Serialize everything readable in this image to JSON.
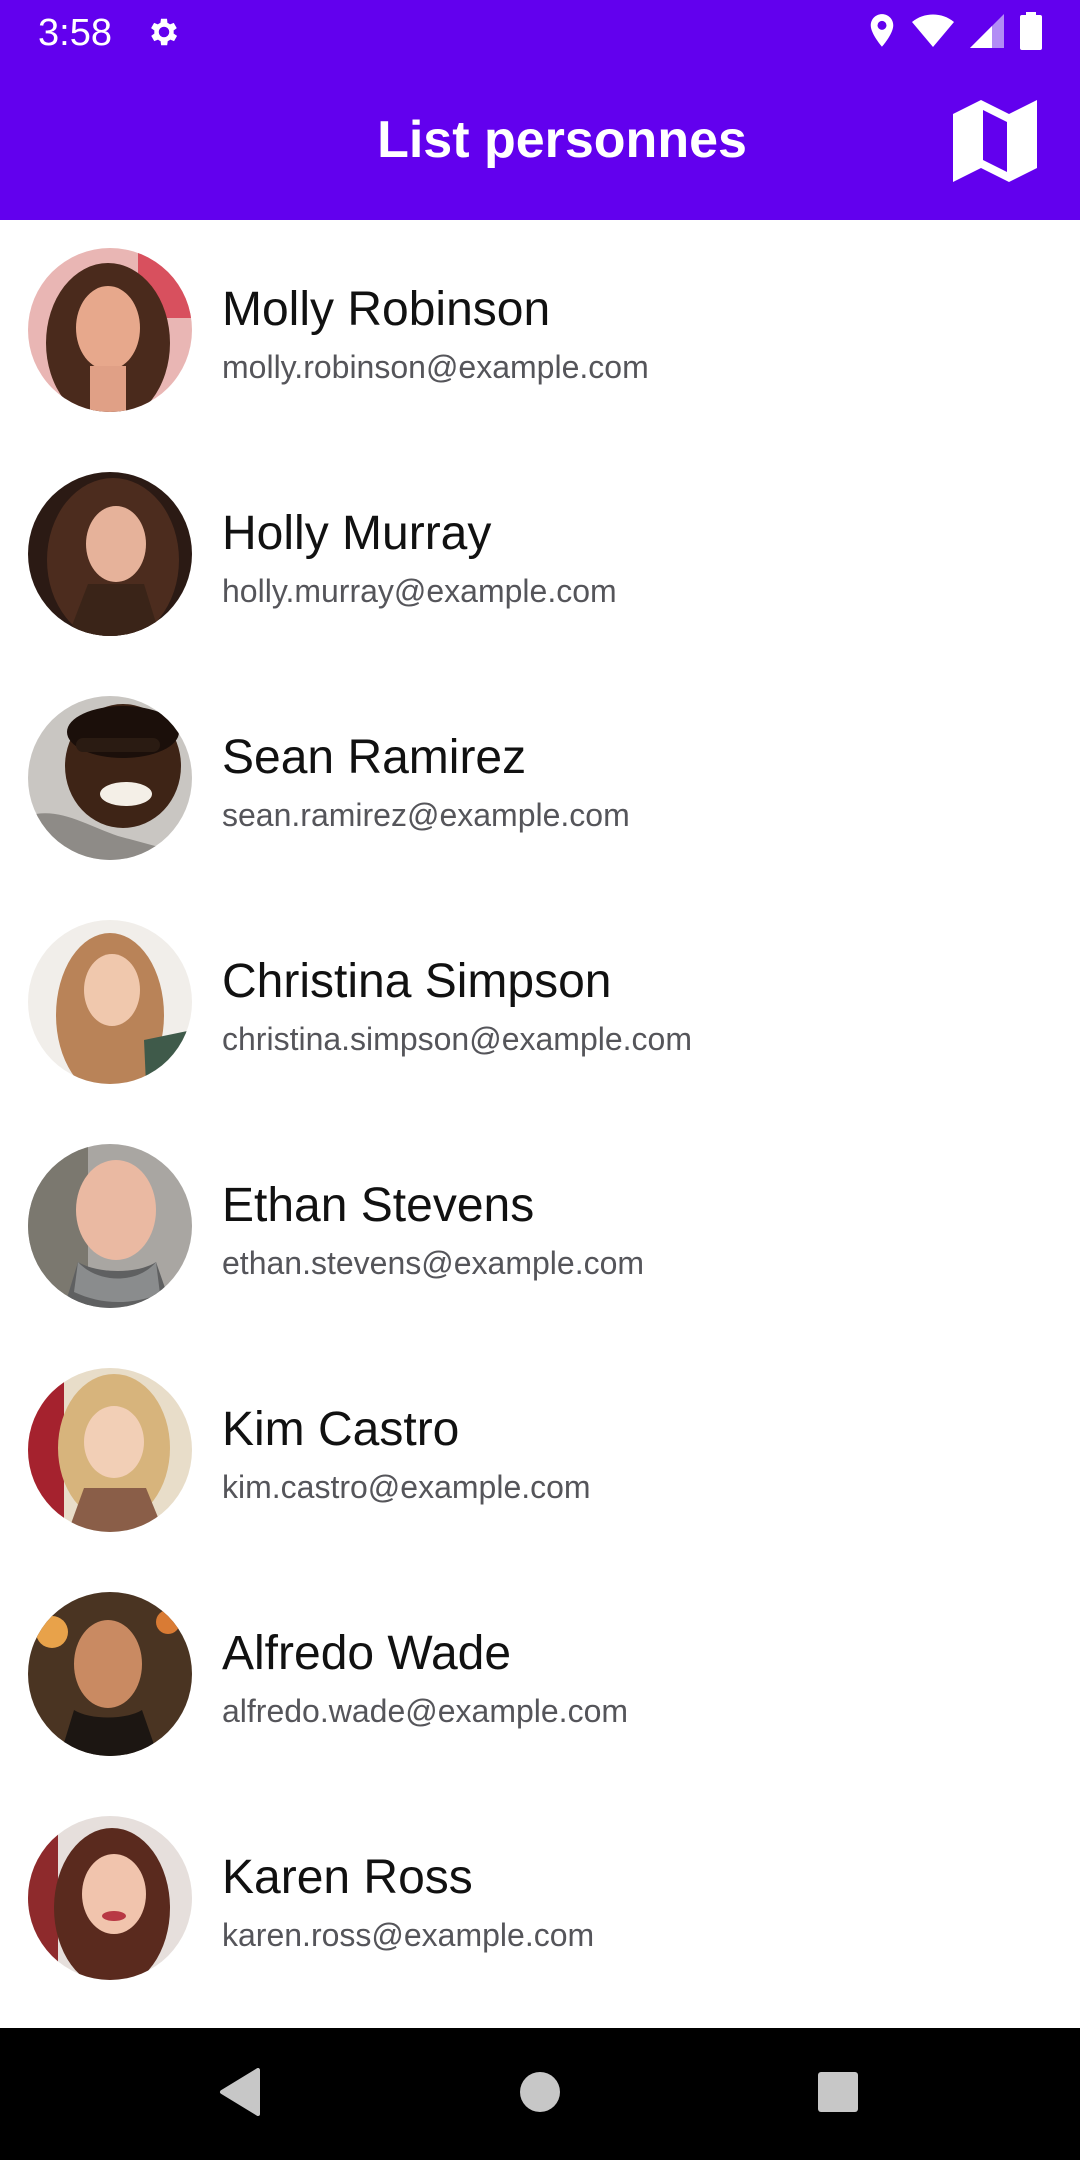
{
  "status_bar": {
    "time": "3:58",
    "left_icons": [
      "settings-icon"
    ],
    "right_icons": [
      "location-icon",
      "wifi-icon",
      "cell-signal-icon",
      "battery-icon"
    ],
    "background": "#6200ee"
  },
  "app_bar": {
    "title": "List personnes",
    "action_icon": "map-icon",
    "background": "#6200ee"
  },
  "people": [
    {
      "name": "Molly Robinson",
      "email": "molly.robinson@example.com"
    },
    {
      "name": "Holly Murray",
      "email": "holly.murray@example.com"
    },
    {
      "name": "Sean Ramirez",
      "email": "sean.ramirez@example.com"
    },
    {
      "name": "Christina Simpson",
      "email": "christina.simpson@example.com"
    },
    {
      "name": "Ethan Stevens",
      "email": "ethan.stevens@example.com"
    },
    {
      "name": "Kim Castro",
      "email": "kim.castro@example.com"
    },
    {
      "name": "Alfredo Wade",
      "email": "alfredo.wade@example.com"
    },
    {
      "name": "Karen Ross",
      "email": "karen.ross@example.com"
    }
  ],
  "nav_bar": {
    "buttons": [
      "back-icon",
      "home-icon",
      "recents-icon"
    ]
  }
}
